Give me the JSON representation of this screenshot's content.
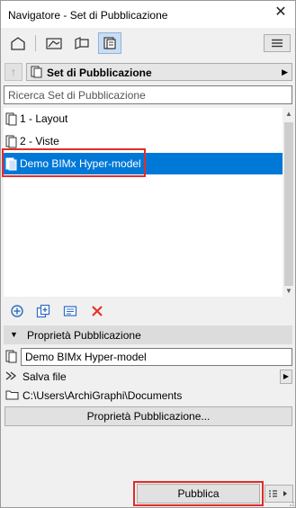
{
  "window": {
    "title": "Navigatore - Set di Pubblicazione",
    "close_glyph": "✕"
  },
  "toolbar": {
    "buttons": [
      "project-map-icon",
      "view-map-icon",
      "layout-book-icon",
      "publisher-sets-icon"
    ],
    "active": "publisher-sets-icon",
    "menu_icon": "hamburger-menu-icon"
  },
  "set_selector": {
    "up_glyph": "↑",
    "label": "Set di Pubblicazione",
    "arrow": "▶"
  },
  "search": {
    "placeholder": "Ricerca Set di Pubblicazione",
    "value": ""
  },
  "tree": {
    "items": [
      {
        "label": "1 - Layout",
        "selected": false
      },
      {
        "label": "2 - Viste",
        "selected": false
      },
      {
        "label": "Demo BIMx Hyper-model",
        "selected": true
      }
    ]
  },
  "actions": [
    "add-set-icon",
    "duplicate-set-icon",
    "set-settings-icon",
    "delete-icon"
  ],
  "properties": {
    "header_label": "Proprietà Pubblicazione",
    "name_value": "Demo BIMx Hyper-model",
    "save_label": "Salva file",
    "path_label": "C:\\Users\\ArchiGraphi\\Documents",
    "properties_button_label": "Proprietà Pubblicazione..."
  },
  "footer": {
    "publish_label": "Pubblica"
  },
  "colors": {
    "selection": "#0078d7",
    "highlight": "#e32b2b",
    "delete": "#e5322d",
    "accent": "#2b6cc4"
  }
}
